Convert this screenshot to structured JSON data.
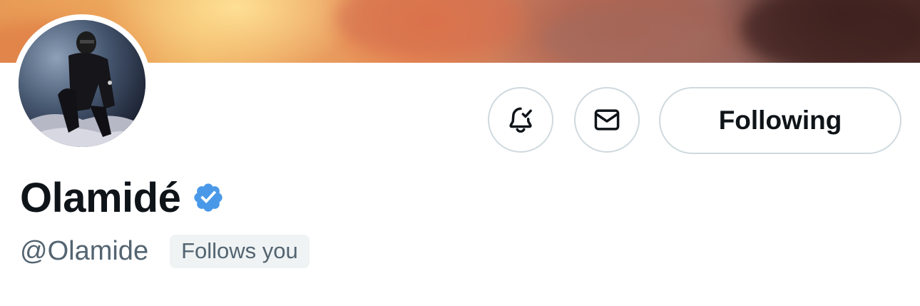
{
  "profile": {
    "display_name": "Olamidé",
    "handle": "@Olamide",
    "follows_you_label": "Follows you",
    "verified_icon": "verified-badge-icon",
    "verified_color": "#4a99e9"
  },
  "actions": {
    "following_label": "Following",
    "notify_icon": "bell-check-icon",
    "message_icon": "envelope-icon"
  },
  "colors": {
    "text_primary": "#0f1419",
    "text_secondary": "#536471",
    "button_border": "#cfd9de",
    "badge_bg": "#eff3f4"
  }
}
